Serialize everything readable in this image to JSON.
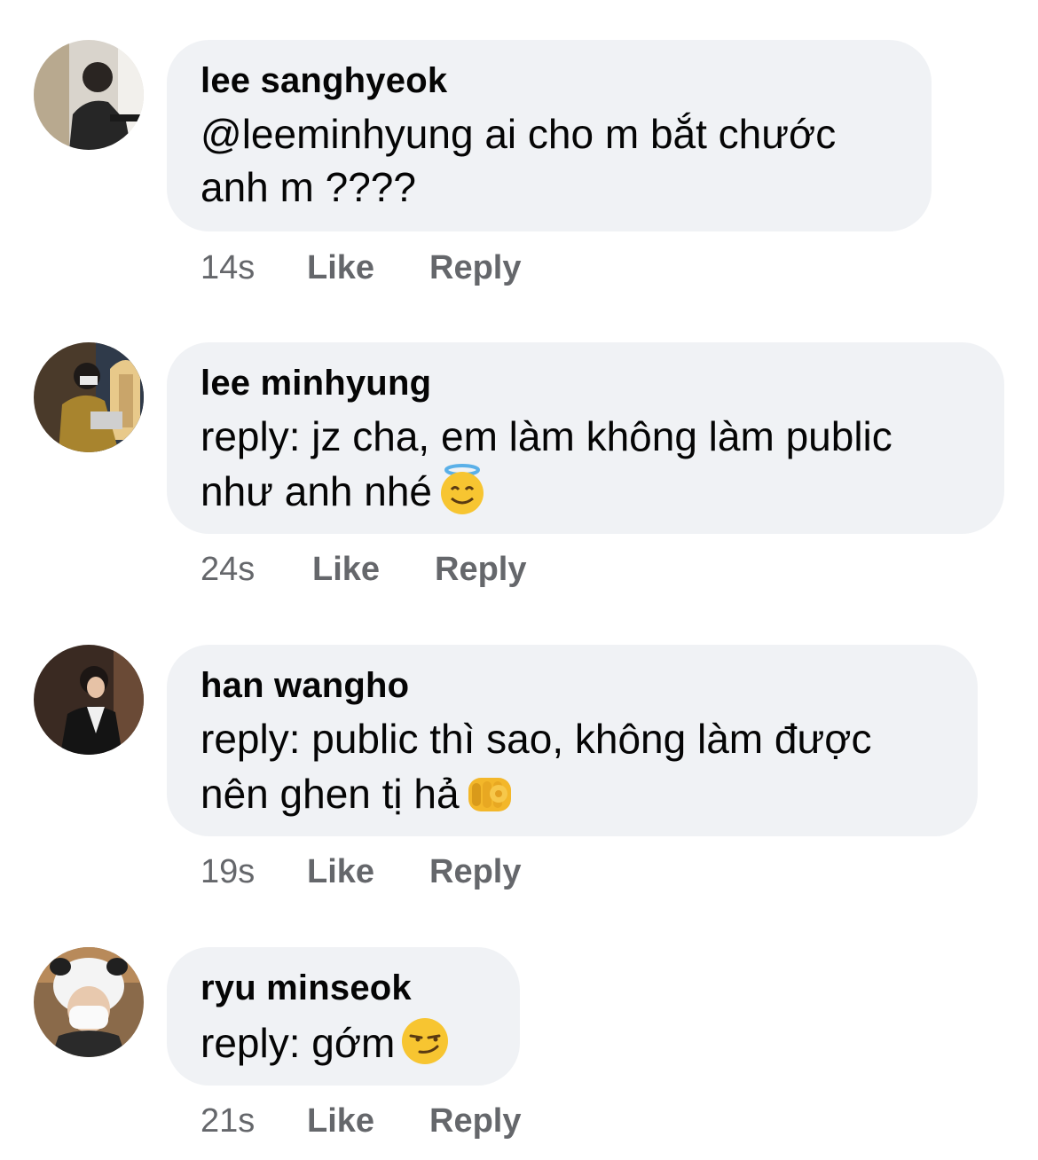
{
  "comments": [
    {
      "author": "lee sanghyeok",
      "text": "@leeminhyung ai cho m bắt chước anh m ????",
      "time": "14s",
      "like_label": "Like",
      "reply_label": "Reply",
      "avatar_icon": "avatar-photo",
      "emoji": ""
    },
    {
      "author": "lee minhyung",
      "text": "reply: jz cha, em làm không làm public như anh nhé",
      "time": "24s",
      "like_label": "Like",
      "reply_label": "Reply",
      "avatar_icon": "avatar-photo",
      "emoji": "smiling-face-with-halo"
    },
    {
      "author": "han wangho",
      "text": "reply: public thì sao, không làm được nên ghen tị hả",
      "time": "19s",
      "like_label": "Like",
      "reply_label": "Reply",
      "avatar_icon": "avatar-photo",
      "emoji": "backhand-index-pointing-at-viewer"
    },
    {
      "author": "ryu minseok",
      "text": "reply: gớm",
      "time": "21s",
      "like_label": "Like",
      "reply_label": "Reply",
      "avatar_icon": "avatar-photo",
      "emoji": "smirking-face"
    }
  ],
  "colors": {
    "bubble": "#f0f2f5",
    "meta_text": "#65676b",
    "body_text": "#050505"
  }
}
